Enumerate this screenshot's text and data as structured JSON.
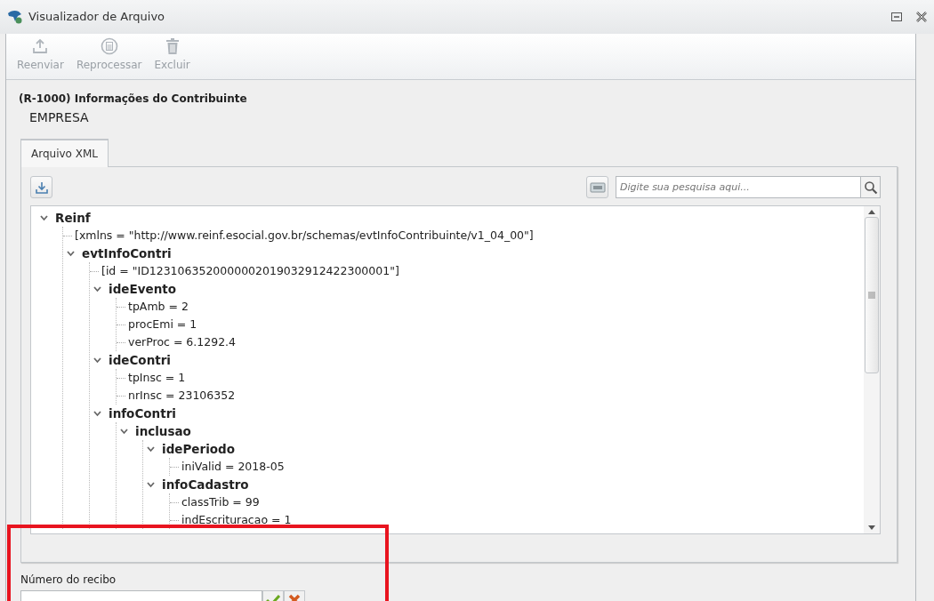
{
  "window": {
    "title": "Visualizador de Arquivo"
  },
  "toolbar": [
    {
      "label": "Reenviar",
      "disabled": true
    },
    {
      "label": "Reprocessar",
      "disabled": true
    },
    {
      "label": "Excluir",
      "disabled": true
    }
  ],
  "header": {
    "title": "(R-1000) Informações do Contribuinte",
    "subtitle": "EMPRESA"
  },
  "tabs": [
    {
      "label": "Arquivo XML",
      "selected": true
    }
  ],
  "search": {
    "placeholder": "Digite sua pesquisa aqui..."
  },
  "tree": [
    {
      "kind": "element",
      "name": "Reinf",
      "expanded": true,
      "children": [
        {
          "kind": "value",
          "text": "[xmlns = \"http://www.reinf.esocial.gov.br/schemas/evtInfoContribuinte/v1_04_00\"]"
        },
        {
          "kind": "element",
          "name": "evtInfoContri",
          "expanded": true,
          "children": [
            {
              "kind": "value",
              "text": "[id = \"ID1231063520000002019032912422300001\"]"
            },
            {
              "kind": "element",
              "name": "ideEvento",
              "expanded": true,
              "children": [
                {
                  "kind": "value",
                  "text": "tpAmb = 2"
                },
                {
                  "kind": "value",
                  "text": "procEmi = 1"
                },
                {
                  "kind": "value",
                  "text": "verProc = 6.1292.4"
                }
              ]
            },
            {
              "kind": "element",
              "name": "ideContri",
              "expanded": true,
              "children": [
                {
                  "kind": "value",
                  "text": "tpInsc = 1"
                },
                {
                  "kind": "value",
                  "text": "nrInsc = 23106352"
                }
              ]
            },
            {
              "kind": "element",
              "name": "infoContri",
              "expanded": true,
              "children": [
                {
                  "kind": "element",
                  "name": "inclusao",
                  "expanded": true,
                  "children": [
                    {
                      "kind": "element",
                      "name": "idePeriodo",
                      "expanded": true,
                      "children": [
                        {
                          "kind": "value",
                          "text": "iniValid = 2018-05"
                        }
                      ]
                    },
                    {
                      "kind": "element",
                      "name": "infoCadastro",
                      "expanded": true,
                      "children": [
                        {
                          "kind": "value",
                          "text": "classTrib = 99"
                        },
                        {
                          "kind": "value",
                          "text": "indEscrituracao = 1"
                        }
                      ]
                    }
                  ]
                }
              ]
            }
          ]
        }
      ]
    }
  ],
  "receipt": {
    "label": "Número do recibo"
  }
}
